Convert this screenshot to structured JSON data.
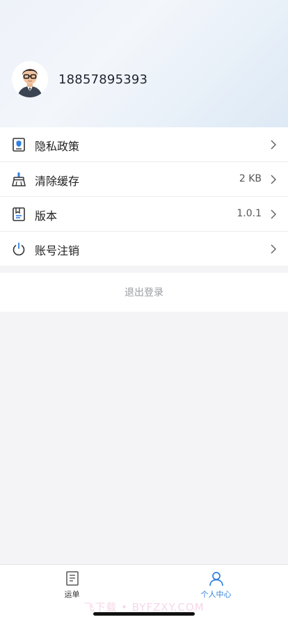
{
  "profile": {
    "phone": "18857895393"
  },
  "menu": {
    "items": [
      {
        "label": "隐私政策",
        "value": ""
      },
      {
        "label": "清除缓存",
        "value": "2 KB"
      },
      {
        "label": "版本",
        "value": "1.0.1"
      },
      {
        "label": "账号注销",
        "value": ""
      }
    ]
  },
  "logout_label": "退出登录",
  "tabbar": {
    "tabs": [
      {
        "label": "运单"
      },
      {
        "label": "个人中心"
      }
    ]
  },
  "watermark": "飞下载 • BYFZXY.COM",
  "colors": {
    "accent": "#2f7fe0",
    "page_bg": "#f4f4f6"
  }
}
